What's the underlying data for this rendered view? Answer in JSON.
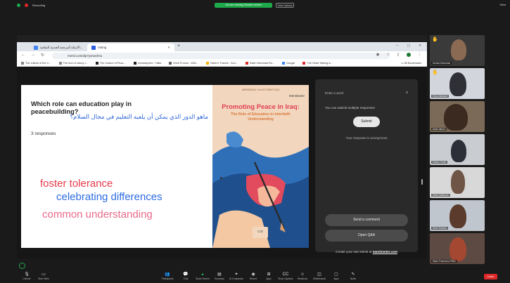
{
  "zoom": {
    "top_left": "Recording",
    "share_banner": "You are viewing Zeinab's screen",
    "view_options": "View Options",
    "top_right": "View",
    "toolbar": [
      {
        "icon": "microphone-icon",
        "label": "Unmute"
      },
      {
        "icon": "video-icon",
        "label": "Start Video"
      },
      {
        "icon": "participants-icon",
        "label": "Participants"
      },
      {
        "icon": "chat-icon",
        "label": "Chat"
      },
      {
        "icon": "share-screen-icon",
        "label": "Share Screen"
      },
      {
        "icon": "summary-icon",
        "label": "Summary"
      },
      {
        "icon": "ai-companion-icon",
        "label": "AI Companion"
      },
      {
        "icon": "record-icon",
        "label": "Record"
      },
      {
        "icon": "apps-icon",
        "label": "Apps"
      },
      {
        "icon": "show-captions-icon",
        "label": "Show Captions"
      },
      {
        "icon": "reactions-icon",
        "label": "Reactions"
      },
      {
        "icon": "whiteboards-icon",
        "label": "Whiteboards"
      },
      {
        "icon": "apps-icon",
        "label": "Apps"
      },
      {
        "icon": "notes-icon",
        "label": "Notes"
      }
    ],
    "leave_label": "Leave"
  },
  "browser": {
    "tabs": [
      {
        "label": "الأسئلة المرجعة الحديثة الثقافية...",
        "active": false
      },
      {
        "label": "Voting",
        "active": true
      }
    ],
    "url": "menti.com/alp7yxnwcfmu",
    "bookmarks": [
      "The culture of the C...",
      "The end of victory i...",
      "The Culture of Peac...",
      "chomsky.info : Talks",
      "Erich Fromm - Wiki...",
      "Oliver's Travels - Sun...",
      "Saleh Hammad Ro...",
      "Google",
      "The Heart Talking in..."
    ],
    "all_bookmarks": "All Bookmarks"
  },
  "slide": {
    "question_en": "Which role can education play in peacebuilding?",
    "question_ar": "ماهو الدور الذي يمكن أن يلعبه التعليم في مجال السلام؟",
    "responses": "3 responses",
    "word_cloud": [
      {
        "word": "foster tolerance",
        "color": "#e6394a"
      },
      {
        "word": "celebrating differences",
        "color": "#2d6be2"
      },
      {
        "word": "common understanding",
        "color": "#e86a8a"
      }
    ],
    "poster": {
      "date": "WEDNESDAY, 2nd OCTOBER 2024",
      "brand": "Mentimeter",
      "title": "Promoting Peace in Iraq:",
      "subtitle": "The Role of Education in Interfaith Understanding",
      "logo_text": "CID"
    }
  },
  "answer_panel": {
    "input_placeholder": "Enter a word",
    "multi_note": "You can submit multiple responses",
    "submit_label": "Submit",
    "anonymous_note": "Your response is anonymous",
    "send_comment": "Send a comment",
    "open_qa": "Open Q&A",
    "create_text": "Create your own Menti at",
    "create_link": "mentimeter.com"
  },
  "participants": [
    {
      "name": "Ahmad Mohamad",
      "hand": true
    },
    {
      "name": "Omar Alaswad",
      "hand": true
    },
    {
      "name": "Amal Jaboor",
      "hand": false
    },
    {
      "name": "Haithm Khalil",
      "hand": false
    },
    {
      "name": "Zahra Mahfouth",
      "hand": false
    },
    {
      "name": "Sahir Mostafa",
      "hand": false
    },
    {
      "name": "Maria Francesca Pettis",
      "hand": false
    }
  ]
}
